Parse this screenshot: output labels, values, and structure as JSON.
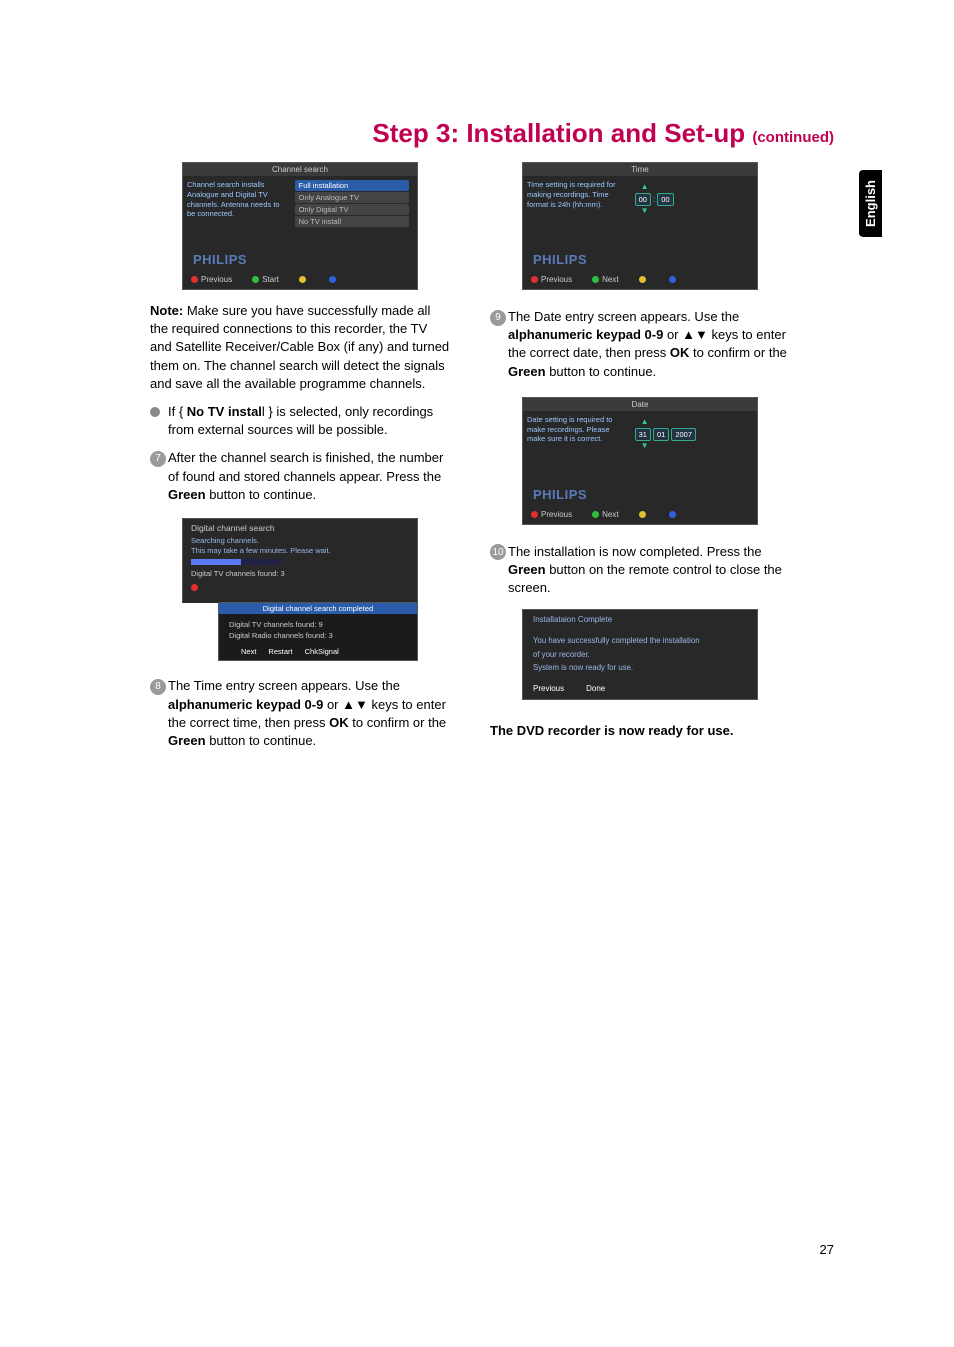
{
  "page": {
    "title_main": "Step 3: Installation and Set-up ",
    "title_cont": "(continued)",
    "side_tab": "English",
    "number": "27"
  },
  "channel_search_scr": {
    "header": "Channel search",
    "left_text": "Channel search installs Analogue and Digital TV channels. Antenna needs to be connected.",
    "options": [
      "Full installation",
      "Only Analogue TV",
      "Only Digital TV",
      "No TV install"
    ],
    "philips": "PHILIPS",
    "btn_prev": "Previous",
    "btn_start": "Start"
  },
  "time_scr": {
    "header": "Time",
    "left_text": "Time setting is required for making recordings. Time format is 24h (hh:mm).",
    "hh": "00",
    "mm": "00",
    "philips": "PHILIPS",
    "btn_prev": "Previous",
    "btn_next": "Next"
  },
  "date_scr": {
    "header": "Date",
    "left_text": "Date setting is required to make recordings. Please make sure it is correct.",
    "dd": "31",
    "mo": "01",
    "yy": "2007",
    "philips": "PHILIPS",
    "btn_prev": "Previous",
    "btn_next": "Next"
  },
  "note_para": {
    "lead": "Note:",
    "rest": " Make sure you have successfully made all the required connections to this recorder, the TV and Satellite Receiver/Cable Box (if any) and turned them on. The channel search will detect the signals and save all the available programme channels."
  },
  "bullet_no_tv": {
    "pre": "If { ",
    "bold": "No TV instal",
    "post": "l } is selected, only recordings from external sources will be possible."
  },
  "step7": {
    "num": "7",
    "text_a": "After the channel search is finished, the number of found and stored channels appear.  Press the ",
    "bold": "Green",
    "text_b": " button to continue."
  },
  "dcs": {
    "header": "Digital channel search",
    "searching": "Searching channels.",
    "wait": "This may take a few minutes. Please wait.",
    "found_top": "Digital TV channels found:  3",
    "completed_bar": "Digital channel search completed",
    "line1": "Digital  TV channels found:  9",
    "line2": "Digital  Radio channels found:  3",
    "btn_next": "Next",
    "btn_restart": "Restart",
    "btn_chk": "ChkSignal"
  },
  "step8": {
    "num": "8",
    "text_a": "The Time entry screen appears.  Use the ",
    "bold1": "alphanumeric keypad 0-9",
    "mid": " or ▲▼ keys to enter the correct time, then press ",
    "bold2": "OK",
    "text_b": " to confirm or the ",
    "bold3": "Green",
    "text_c": " button to continue."
  },
  "step9": {
    "num": "9",
    "text_a": "The Date entry screen appears.  Use the ",
    "bold1": "alphanumeric keypad 0-9",
    "mid": " or ▲▼ keys to enter the correct date, then press ",
    "bold2": "OK",
    "text_b": " to confirm or the ",
    "bold3": "Green",
    "text_c": " button to continue."
  },
  "step10": {
    "num": "10",
    "text_a": "The installation is now completed.  Press the ",
    "bold": "Green",
    "text_b": " button on the remote control to close the screen."
  },
  "install_complete_scr": {
    "header": "Installataion Complete",
    "line1": "You have successfully completed the installation",
    "line2": "of your recorder.",
    "line3": "System is now ready for use.",
    "btn_prev": "Previous",
    "btn_done": "Done"
  },
  "final": "The DVD recorder is now ready for use."
}
